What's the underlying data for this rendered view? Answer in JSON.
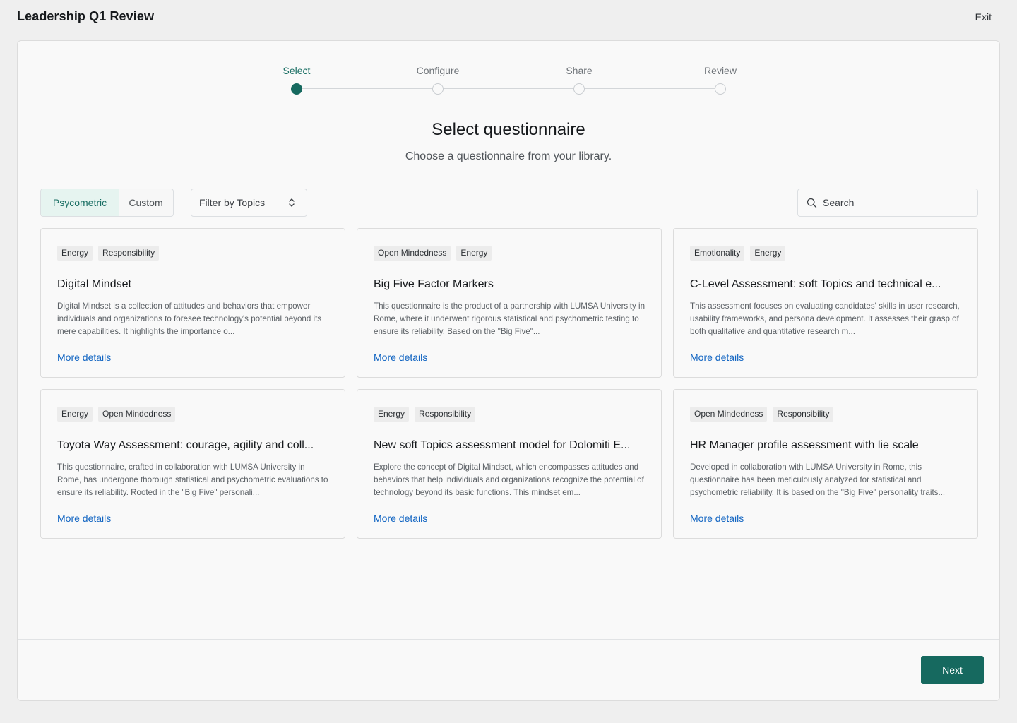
{
  "header": {
    "title": "Leadership Q1 Review",
    "exit_label": "Exit"
  },
  "stepper": {
    "steps": [
      {
        "label": "Select",
        "active": true
      },
      {
        "label": "Configure",
        "active": false
      },
      {
        "label": "Share",
        "active": false
      },
      {
        "label": "Review",
        "active": false
      }
    ]
  },
  "main": {
    "title": "Select questionnaire",
    "subtitle": "Choose a questionnaire from your library."
  },
  "toolbar": {
    "tabs": [
      {
        "label": "Psycometric",
        "selected": true
      },
      {
        "label": "Custom",
        "selected": false
      }
    ],
    "filter_label": "Filter by Topics",
    "search_placeholder": "Search"
  },
  "cards": [
    {
      "tags": [
        "Energy",
        "Responsibility"
      ],
      "title": "Digital Mindset",
      "description": "Digital Mindset is a collection of attitudes and behaviors that empower individuals and organizations to foresee technology's potential beyond its mere capabilities. It highlights the importance o...",
      "link": "More details"
    },
    {
      "tags": [
        "Open Mindedness",
        "Energy"
      ],
      "title": "Big Five Factor Markers",
      "description": "This questionnaire is the product of a partnership with LUMSA University in Rome, where it underwent rigorous statistical and psychometric testing to ensure its reliability. Based on the \"Big Five\"...",
      "link": "More details"
    },
    {
      "tags": [
        "Emotionality",
        "Energy"
      ],
      "title": "C-Level Assessment: soft Topics and technical e...",
      "description": "This assessment focuses on evaluating candidates' skills in user research, usability frameworks, and persona development. It assesses their grasp of both qualitative and quantitative research m...",
      "link": "More details"
    },
    {
      "tags": [
        "Energy",
        "Open Mindedness"
      ],
      "title": "Toyota Way Assessment: courage, agility and coll...",
      "description": "This questionnaire, crafted in collaboration with LUMSA University in Rome, has undergone thorough statistical and psychometric evaluations to ensure its reliability. Rooted in the \"Big Five\" personali...",
      "link": "More details"
    },
    {
      "tags": [
        "Energy",
        "Responsibility"
      ],
      "title": "New soft Topics assessment model for Dolomiti E...",
      "description": "Explore the concept of Digital Mindset, which encompasses attitudes and behaviors that help individuals and organizations recognize the potential of technology beyond its basic functions. This mindset em...",
      "link": "More details"
    },
    {
      "tags": [
        "Open Mindedness",
        "Responsibility"
      ],
      "title": "HR Manager profile assessment with lie scale",
      "description": "Developed in collaboration with LUMSA University in Rome, this questionnaire has been meticulously analyzed for statistical and psychometric reliability. It is based on the \"Big Five\" personality traits...",
      "link": "More details"
    }
  ],
  "footer": {
    "next_label": "Next"
  },
  "colors": {
    "accent": "#16695f",
    "accent_light": "#e6f4f0",
    "link": "#1265c2"
  }
}
